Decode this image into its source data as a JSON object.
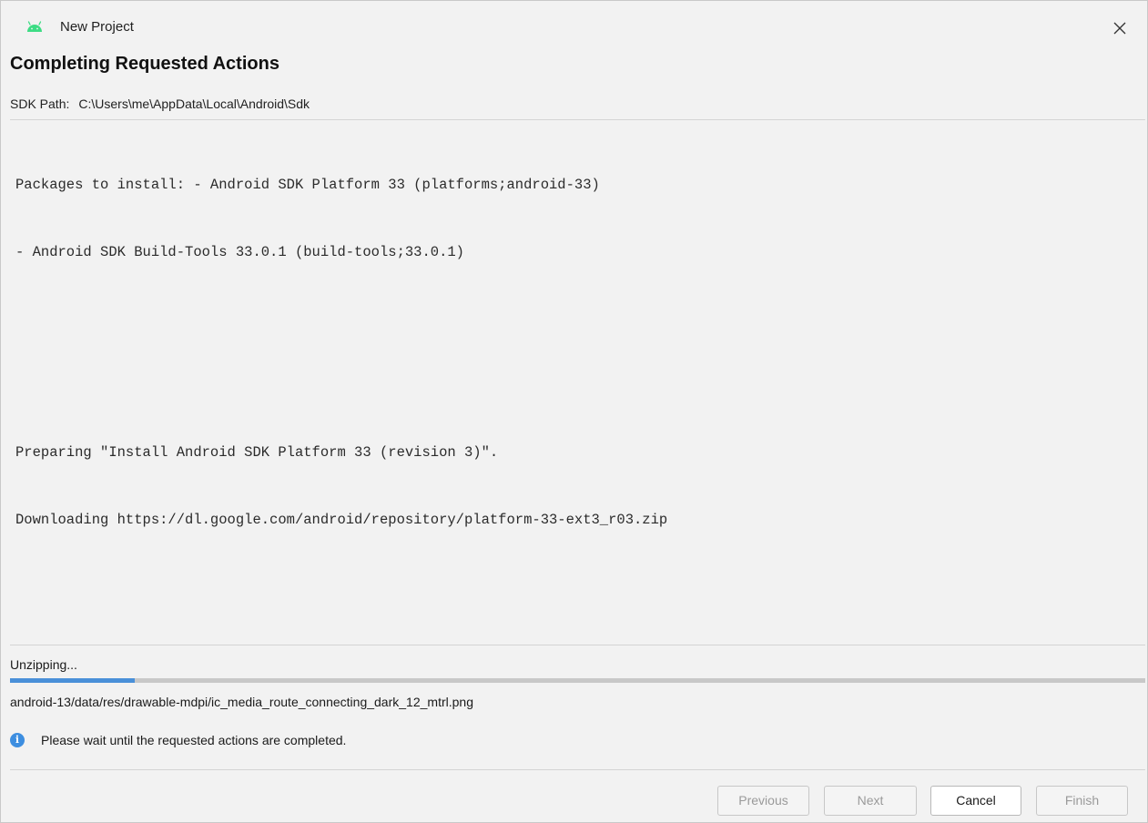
{
  "window": {
    "title": "New Project",
    "close_symbol": "✕",
    "icon": "android-icon"
  },
  "heading": "Completing Requested Actions",
  "sdk": {
    "label": "SDK Path:",
    "path": "C:\\Users\\me\\AppData\\Local\\Android\\Sdk"
  },
  "log": {
    "lines": [
      "Packages to install: - Android SDK Platform 33 (platforms;android-33)",
      "- Android SDK Build-Tools 33.0.1 (build-tools;33.0.1)",
      "",
      "",
      "Preparing \"Install Android SDK Platform 33 (revision 3)\".",
      "Downloading https://dl.google.com/android/repository/platform-33-ext3_r03.zip"
    ]
  },
  "status": {
    "text": "Unzipping...",
    "progress_fraction": 0.11,
    "current_file": "android-13/data/res/drawable-mdpi/ic_media_route_connecting_dark_12_mtrl.png"
  },
  "info": {
    "icon": "info-icon",
    "message": "Please wait until the requested actions are completed."
  },
  "buttons": {
    "previous": "Previous",
    "next": "Next",
    "cancel": "Cancel",
    "finish": "Finish"
  },
  "colors": {
    "accent": "#4a90d9",
    "android_green": "#3ddc84",
    "info_blue": "#3d8ee0"
  }
}
